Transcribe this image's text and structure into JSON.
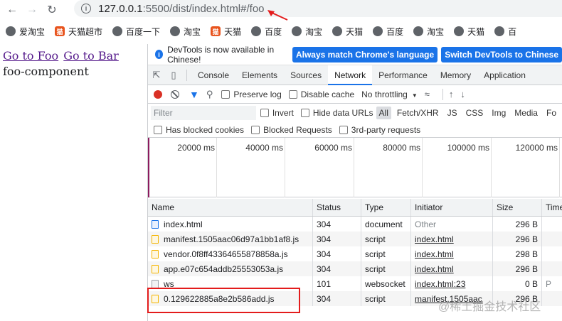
{
  "browser": {
    "url_host": "127.0.0.1",
    "url_rest": ":5500/dist/index.html#/foo",
    "bookmarks": [
      {
        "label": "爱淘宝",
        "icon": "globe-icon"
      },
      {
        "label": "天猫超市",
        "icon": "tmall-icon"
      },
      {
        "label": "百度一下",
        "icon": "globe-icon"
      },
      {
        "label": "淘宝",
        "icon": "globe-icon"
      },
      {
        "label": "天猫",
        "icon": "tmall-icon"
      },
      {
        "label": "百度",
        "icon": "globe-icon"
      },
      {
        "label": "淘宝",
        "icon": "globe-icon"
      },
      {
        "label": "天猫",
        "icon": "globe-icon"
      },
      {
        "label": "百度",
        "icon": "globe-icon"
      },
      {
        "label": "淘宝",
        "icon": "globe-icon"
      },
      {
        "label": "天猫",
        "icon": "globe-icon"
      },
      {
        "label": "百",
        "icon": "globe-icon"
      }
    ]
  },
  "page": {
    "link_foo": "Go to Foo",
    "link_bar": "Go to Bar",
    "component_text": "foo-component"
  },
  "devtools": {
    "infobar": {
      "text": "DevTools is now available in Chinese!",
      "btn_match": "Always match Chrome's language",
      "btn_switch": "Switch DevTools to Chinese"
    },
    "tabs": [
      "Console",
      "Elements",
      "Sources",
      "Network",
      "Performance",
      "Memory",
      "Application"
    ],
    "active_tab": "Network",
    "toolbar": {
      "preserve_log": "Preserve log",
      "disable_cache": "Disable cache",
      "throttling": "No throttling"
    },
    "filter": {
      "placeholder": "Filter",
      "invert": "Invert",
      "hide_data_urls": "Hide data URLs",
      "types": [
        "All",
        "Fetch/XHR",
        "JS",
        "CSS",
        "Img",
        "Media",
        "Fo"
      ],
      "blocked_cookies": "Has blocked cookies",
      "blocked_requests": "Blocked Requests",
      "third_party": "3rd-party requests"
    },
    "timeline": [
      "20000 ms",
      "40000 ms",
      "60000 ms",
      "80000 ms",
      "100000 ms",
      "120000 ms"
    ],
    "columns": {
      "name": "Name",
      "status": "Status",
      "type": "Type",
      "initiator": "Initiator",
      "size": "Size",
      "time": "Time"
    },
    "rows": [
      {
        "name": "index.html",
        "status": "304",
        "type": "document",
        "initiator": "Other",
        "size": "296 B",
        "time": "",
        "kind": "doc"
      },
      {
        "name": "manifest.1505aac06d97a1bb1af8.js",
        "status": "304",
        "type": "script",
        "initiator": "index.html",
        "size": "296 B",
        "time": "",
        "kind": "js"
      },
      {
        "name": "vendor.0f8ff43364655878858a.js",
        "status": "304",
        "type": "script",
        "initiator": "index.html",
        "size": "298 B",
        "time": "",
        "kind": "js"
      },
      {
        "name": "app.e07c654addb25553053a.js",
        "status": "304",
        "type": "script",
        "initiator": "index.html",
        "size": "296 B",
        "time": "",
        "kind": "js"
      },
      {
        "name": "ws",
        "status": "101",
        "type": "websocket",
        "initiator": "index.html:23",
        "size": "0 B",
        "time": "P",
        "kind": "ws"
      },
      {
        "name": "0.129622885a8e2b586add.js",
        "status": "304",
        "type": "script",
        "initiator": "manifest.1505aac",
        "size": "296 B",
        "time": "",
        "kind": "js"
      }
    ]
  },
  "watermark": "@稀土掘金技术社区",
  "colors": {
    "accent": "#1a73e8",
    "highlight": "#e31c1c",
    "link": "#551a8b"
  }
}
